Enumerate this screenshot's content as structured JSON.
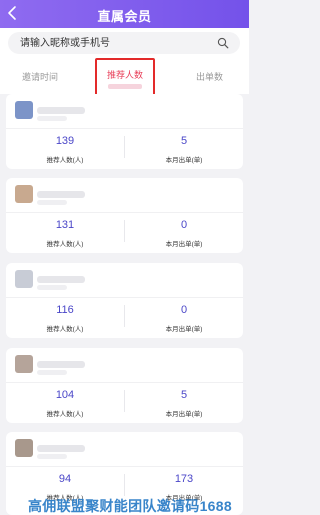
{
  "header": {
    "title": "直属会员"
  },
  "search": {
    "placeholder": "请输入昵称或手机号"
  },
  "tabs": [
    {
      "label": "邀请时间"
    },
    {
      "label": "推荐人数"
    },
    {
      "label": "出单数"
    }
  ],
  "members": [
    {
      "left_value": "139",
      "right_value": "5",
      "avatar_color": "#7c94c8"
    },
    {
      "left_value": "131",
      "right_value": "0",
      "avatar_color": "#c8a98f"
    },
    {
      "left_value": "116",
      "right_value": "0",
      "avatar_color": "#c8ccd6"
    },
    {
      "left_value": "104",
      "right_value": "5",
      "avatar_color": "#b5a49a"
    },
    {
      "left_value": "94",
      "right_value": "173",
      "avatar_color": "#a8988c"
    }
  ],
  "labels": {
    "left": "推荐人数(人)",
    "right": "本月出单(单)"
  },
  "colors": {
    "header": "#7f5cee",
    "accent": "#4a46c8",
    "active_tab": "#e8405a"
  },
  "watermark": "高佣联盟聚财能团队邀请码1688"
}
